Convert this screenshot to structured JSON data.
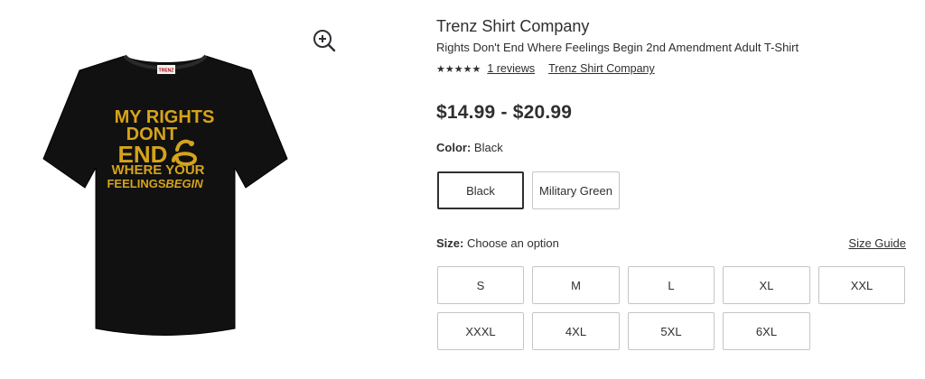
{
  "product": {
    "brand": "Trenz Shirt Company",
    "title": "Rights Don't End Where Feelings Begin 2nd Amendment Adult T-Shirt",
    "rating_stars": "★★★★★",
    "reviews_label": "1 reviews",
    "seller_link": "Trenz Shirt Company",
    "price": "$14.99 - $20.99"
  },
  "image": {
    "shirt_lines": [
      "MY RIGHTS",
      "DONT",
      "END",
      "WHERE YOUR",
      "FEELINGS",
      "BEGIN"
    ],
    "tag_text": "TRENZ",
    "shirt_color": "#111111",
    "print_color": "#d6a31a",
    "zoom_icon": "zoom-in-icon"
  },
  "color": {
    "label": "Color:",
    "value": "Black",
    "options": [
      {
        "label": "Black",
        "selected": true
      },
      {
        "label": "Military Green",
        "selected": false
      }
    ]
  },
  "size": {
    "label": "Size:",
    "value": "Choose an option",
    "guide_link": "Size Guide",
    "options": [
      "S",
      "M",
      "L",
      "XL",
      "XXL",
      "XXXL",
      "4XL",
      "5XL",
      "6XL"
    ]
  }
}
